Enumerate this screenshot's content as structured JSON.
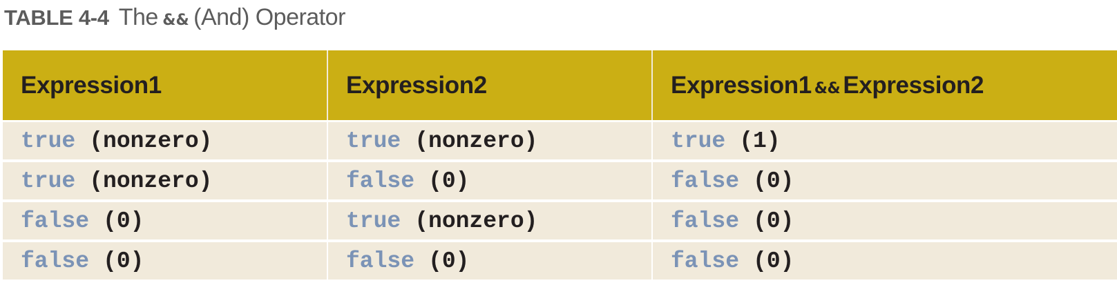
{
  "caption": {
    "number": "TABLE 4-4",
    "title_prefix": "The",
    "operator": "&&",
    "title_suffix": "(And) Operator"
  },
  "table": {
    "headers": [
      {
        "left": "Expression1"
      },
      {
        "left": "Expression2"
      },
      {
        "left": "Expression1",
        "operator": "&&",
        "right": "Expression2"
      }
    ],
    "rows": [
      [
        {
          "value": "true",
          "code": "(nonzero)"
        },
        {
          "value": "true",
          "code": "(nonzero)"
        },
        {
          "value": "true",
          "code": "(1)"
        }
      ],
      [
        {
          "value": "true",
          "code": "(nonzero)"
        },
        {
          "value": "false",
          "code": "(0)"
        },
        {
          "value": "false",
          "code": "(0)"
        }
      ],
      [
        {
          "value": "false",
          "code": "(0)"
        },
        {
          "value": "true",
          "code": "(nonzero)"
        },
        {
          "value": "false",
          "code": "(0)"
        }
      ],
      [
        {
          "value": "false",
          "code": "(0)"
        },
        {
          "value": "false",
          "code": "(0)"
        },
        {
          "value": "false",
          "code": "(0)"
        }
      ]
    ]
  },
  "colors": {
    "header_bg": "#cbaf14",
    "cell_bg": "#f1eadb",
    "keyword": "#7b93b6",
    "text": "#231f20",
    "caption_text": "#5c5c5c"
  }
}
